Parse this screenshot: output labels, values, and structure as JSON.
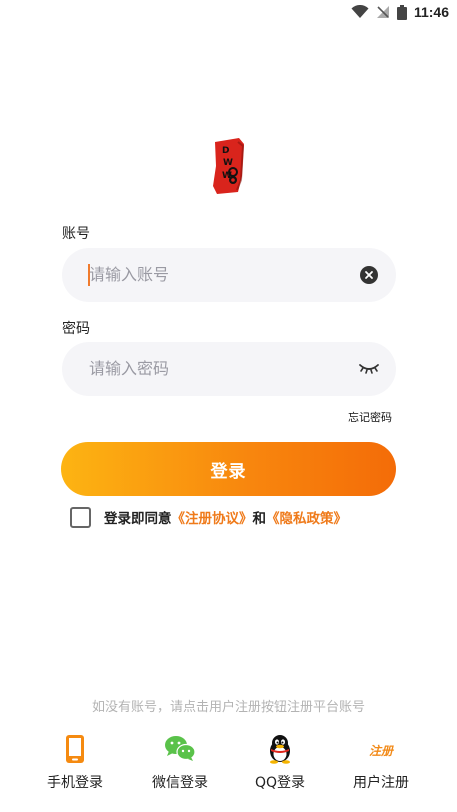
{
  "status_bar": {
    "time": "11:46"
  },
  "logo": {
    "text": "DWWO"
  },
  "account": {
    "label": "账号",
    "placeholder": "请输入账号"
  },
  "password": {
    "label": "密码",
    "placeholder": "请输入密码"
  },
  "forgot_password": "忘记密码",
  "login_button": "登录",
  "agreement": {
    "prefix": "登录即同意",
    "terms": "《注册协议》",
    "and": "和",
    "privacy": "《隐私政策》",
    "checked": false
  },
  "hint": "如没有账号，请点击用户注册按钮注册平台账号",
  "bottom_nav": {
    "phone_login": "手机登录",
    "wechat_login": "微信登录",
    "qq_login": "QQ登录",
    "register": "用户注册",
    "register_icon_text": "注册"
  },
  "colors": {
    "accent": "#f58a10",
    "gradient_start": "#fdb412",
    "gradient_end": "#f46c08",
    "input_bg": "#f5f5f8",
    "logo_red": "#d9241c",
    "wechat_green": "#5ac24a"
  }
}
